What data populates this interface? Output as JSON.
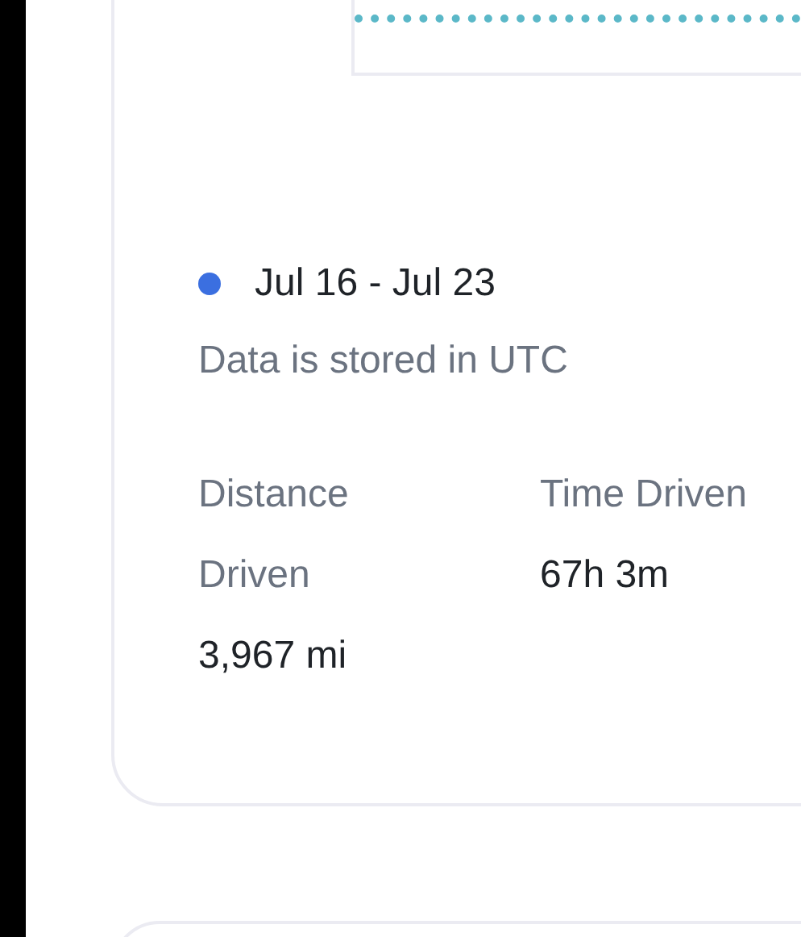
{
  "period": {
    "label": "Jul 16 - Jul 23",
    "color": "#3b6fe0"
  },
  "note": "Data is stored in UTC",
  "stats": [
    {
      "label": "Distance Driven",
      "value": "3,967 mi"
    },
    {
      "label": "Time Driven",
      "value": "67h 3m"
    }
  ]
}
